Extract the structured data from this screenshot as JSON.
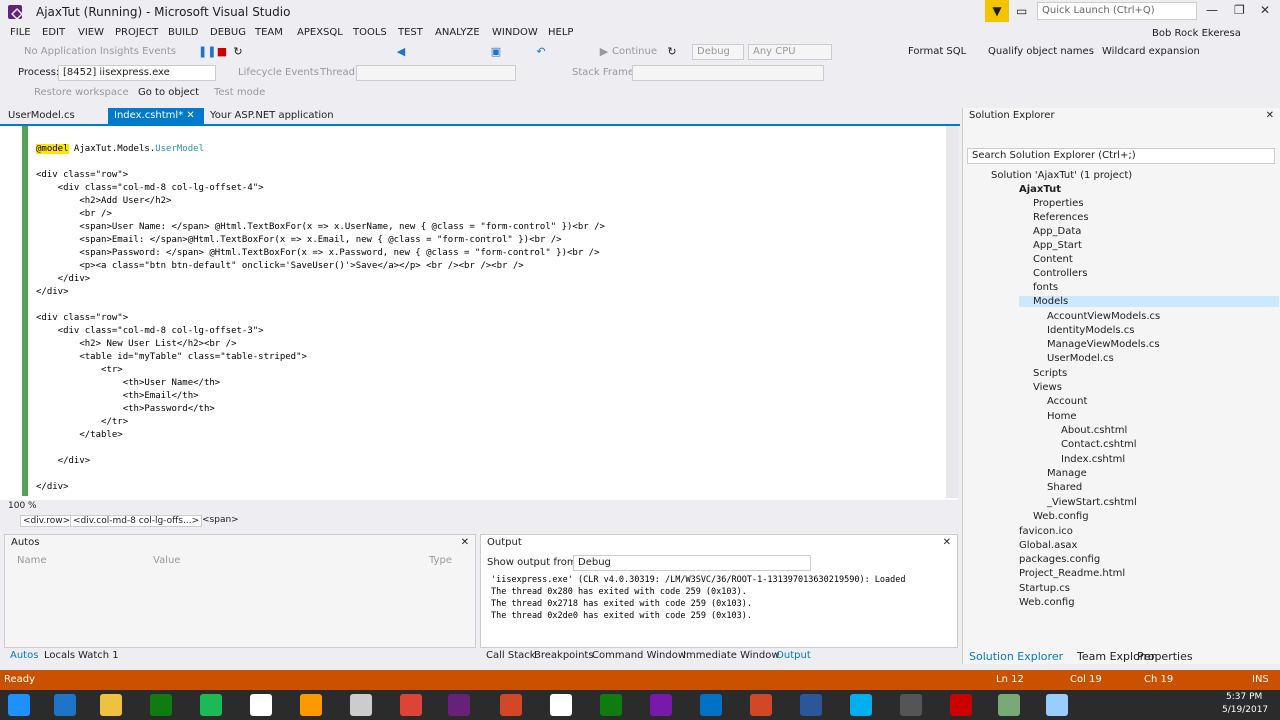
{
  "window": {
    "title": "AjaxTut (Running) - Microsoft Visual Studio",
    "quick_launch": "Quick Launch (Ctrl+Q)",
    "user": "Bob Rock Ekeresa"
  },
  "menu": [
    "FILE",
    "EDIT",
    "VIEW",
    "PROJECT",
    "BUILD",
    "DEBUG",
    "TEAM",
    "APEXSQL",
    "TOOLS",
    "TEST",
    "ANALYZE",
    "WINDOW",
    "HELP"
  ],
  "toolbar": {
    "insights": "No Application Insights Events",
    "continue": "Continue",
    "config": "Debug",
    "platform": "Any CPU",
    "format_sql": "Format SQL",
    "qualify": "Qualify object names",
    "wildcard": "Wildcard expansion",
    "process_label": "Process:",
    "process_value": "[8452] iisexpress.exe",
    "lifecycle": "Lifecycle Events",
    "thread_label": "Thread:",
    "stack_label": "Stack Frame:",
    "restore": "Restore workspace",
    "goto": "Go to object",
    "testmode": "Test mode"
  },
  "tabs": [
    {
      "label": "UserModel.cs"
    },
    {
      "label": "Index.cshtml*"
    },
    {
      "label": "Your ASP.NET application"
    }
  ],
  "code": {
    "l1a": "@model",
    "l1b": " AjaxTut.Models.",
    "l1c": "UserModel",
    "lines": [
      "<div class=\"row\">",
      "    <div class=\"col-md-8 col-lg-offset-4\">",
      "        <h2>Add User</h2>",
      "        <br />",
      "        <span>User Name: </span> @Html.TextBoxFor(x => x.UserName, new { @class = \"form-control\" })<br />",
      "        <span>Email: </span>@Html.TextBoxFor(x => x.Email, new { @class = \"form-control\" })<br />",
      "        <span>Password: </span> @Html.TextBoxFor(x => x.Password, new { @class = \"form-control\" })<br />",
      "        <p><a class=\"btn btn-default\" onclick='SaveUser()'>Save</a></p> <br /><br /><br />",
      "    </div>",
      "</div>",
      "",
      "<div class=\"row\">",
      "    <div class=\"col-md-8 col-lg-offset-3\">",
      "        <h2> New User List</h2><br />",
      "        <table id=\"myTable\" class=\"table-striped\">",
      "            <tr>",
      "                <th>User Name</th>",
      "                <th>Email</th>",
      "                <th>Password</th>",
      "            </tr>",
      "        </table>",
      "",
      "    </div>",
      "",
      "</div>"
    ]
  },
  "editor": {
    "zoom": "100 %",
    "crumbs": [
      "<div.row>",
      "<div.col-md-8 col-lg-offs...>",
      "<span>"
    ]
  },
  "autos": {
    "title": "Autos",
    "col_name": "Name",
    "col_value": "Value",
    "col_type": "Type"
  },
  "output": {
    "title": "Output",
    "from_label": "Show output from:",
    "from_value": "Debug",
    "lines": [
      "'iisexpress.exe' (CLR v4.0.30319: /LM/W3SVC/36/ROOT-1-131397013630219590): Loaded",
      "The thread 0x280 has exited with code 259 (0x103).",
      "The thread 0x2718 has exited with code 259 (0x103).",
      "The thread 0x2de0 has exited with code 259 (0x103)."
    ]
  },
  "bottom_left_tabs": [
    "Autos",
    "Locals",
    "Watch 1"
  ],
  "bottom_right_tabs": [
    "Call Stack",
    "Breakpoints",
    "Command Window",
    "Immediate Window",
    "Output"
  ],
  "solution_explorer": {
    "title": "Solution Explorer",
    "search": "Search Solution Explorer (Ctrl+;)",
    "items": [
      "Solution 'AjaxTut' (1 project)",
      "AjaxTut",
      "Properties",
      "References",
      "App_Data",
      "App_Start",
      "Content",
      "Controllers",
      "fonts",
      "Models",
      "AccountViewModels.cs",
      "IdentityModels.cs",
      "ManageViewModels.cs",
      "UserModel.cs",
      "Scripts",
      "Views",
      "Account",
      "Home",
      "About.cshtml",
      "Contact.cshtml",
      "Index.cshtml",
      "Manage",
      "Shared",
      "_ViewStart.cshtml",
      "Web.config",
      "favicon.ico",
      "Global.asax",
      "packages.config",
      "Project_Readme.html",
      "Startup.cs",
      "Web.config"
    ],
    "bottom_tabs": [
      "Solution Explorer",
      "Team Explorer",
      "Properties"
    ]
  },
  "status": {
    "left": "Ready",
    "ln": "Ln 12",
    "col": "Col 19",
    "ch": "Ch 19",
    "ins": "INS"
  },
  "clock": {
    "time": "5:37 PM",
    "date": "5/19/2017"
  },
  "colors": {
    "accent": "#007acc",
    "status": "#ca5100",
    "vs_purple": "#68217a"
  }
}
